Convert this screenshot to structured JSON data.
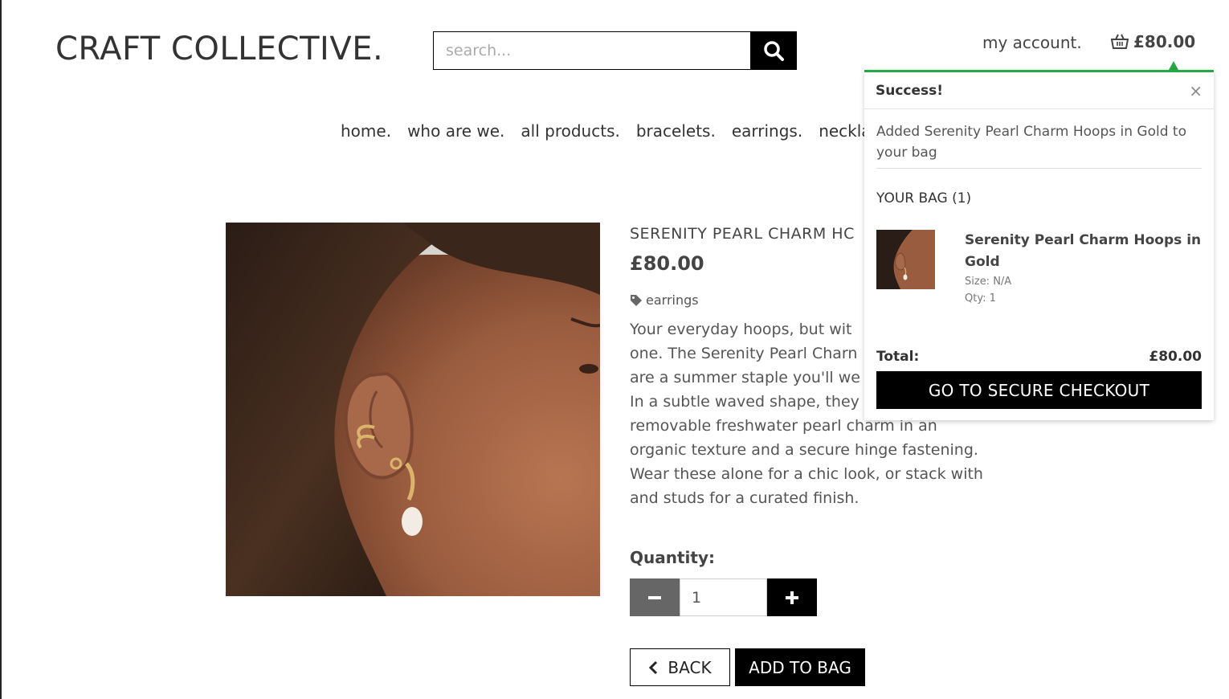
{
  "header": {
    "logo": "CRAFT COLLECTIVE.",
    "search_placeholder": "search...",
    "account_label": "my account.",
    "bag_total": "£80.00"
  },
  "nav": {
    "items": [
      {
        "label": "home."
      },
      {
        "label": "who are we."
      },
      {
        "label": "all products."
      },
      {
        "label": "bracelets."
      },
      {
        "label": "earrings."
      },
      {
        "label": "neckla"
      }
    ]
  },
  "product": {
    "name": "SERENITY PEARL CHARM HC",
    "price": "£80.00",
    "category": "earrings",
    "description_lines": [
      "Your everyday hoops, but wit",
      "one. The Serenity Pearl Charn",
      "are a summer staple you'll we",
      "In a subtle waved shape, they",
      "removable freshwater pearl charm in an",
      "organic texture and a secure hinge fastening.",
      "Wear these alone for a chic look, or stack with",
      "and studs for a curated finish."
    ],
    "quantity_label": "Quantity:",
    "quantity_value": "1",
    "back_label": "BACK",
    "add_label": "ADD TO BAG"
  },
  "toast": {
    "title": "Success!",
    "close": "×",
    "message": "Added Serenity Pearl Charm Hoops in Gold to your bag",
    "bag_heading": "YOUR BAG (1)",
    "item": {
      "name": "Serenity Pearl Charm Hoops in Gold",
      "size": "Size: N/A",
      "qty": "Qty: 1"
    },
    "total_label": "Total:",
    "total_value": "£80.00",
    "checkout_label": "GO TO SECURE CHECKOUT"
  },
  "colors": {
    "success": "#28a745",
    "primary": "#000000",
    "minus_button": "#666666"
  },
  "icons": [
    "search-icon",
    "basket-icon",
    "tag-icon",
    "minus-icon",
    "plus-icon",
    "chevron-left-icon",
    "close-icon"
  ]
}
